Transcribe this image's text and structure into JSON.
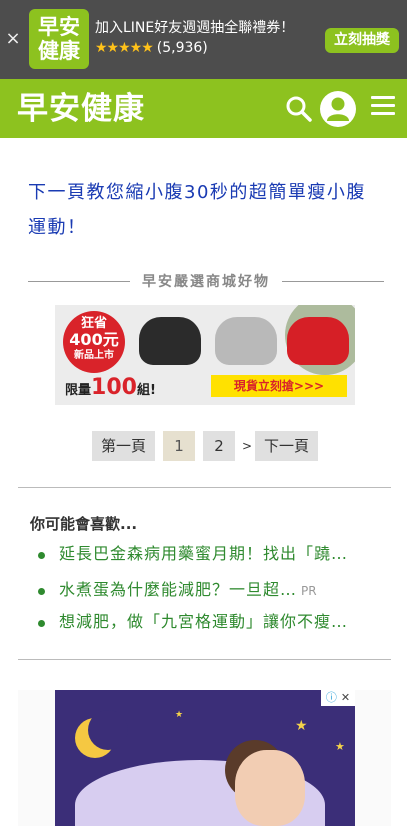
{
  "app_banner": {
    "logo_line1": "早安",
    "logo_line2": "健康",
    "title": "加入LINE好友週週抽全聯禮券！",
    "stars": "★★★★★",
    "rating_count": "(5,936)",
    "cta_label": "立刻抽獎",
    "close_symbol": "×"
  },
  "header": {
    "logo_text": "早安健康"
  },
  "article": {
    "next_page_text": "下一頁教您縮小腹30秒的超簡單瘦小腹運動！"
  },
  "shop_section": {
    "heading": "早安嚴選商城好物",
    "ad": {
      "badge_hot": "狂省",
      "badge_price": "400元",
      "badge_new": "新品上市",
      "limited_prefix": "限量",
      "limited_num": "100",
      "limited_suffix": "組!",
      "stock_text": "現貨立刻搶>>>"
    }
  },
  "pagination": {
    "first": "第一頁",
    "pages": [
      "1",
      "2"
    ],
    "separator": ">",
    "next": "下一頁"
  },
  "recommendations": {
    "heading": "你可能會喜歡...",
    "items": [
      {
        "title": "延長巴金森病用藥蜜月期！找出「蹺…",
        "pr": ""
      },
      {
        "title": "水煮蛋為什麼能減肥？一旦超…",
        "pr": "PR"
      },
      {
        "title": "想減肥，做「九宮格運動」讓你不瘦…",
        "pr": ""
      }
    ]
  },
  "bottom_ad": {
    "choices_label": "ⓘ",
    "close_label": "✕"
  },
  "colors": {
    "brand_green": "#8dc21f",
    "banner_bg": "#4d4d4d",
    "link_blue": "#1a3bb3",
    "rec_green": "#2f8a2f"
  }
}
